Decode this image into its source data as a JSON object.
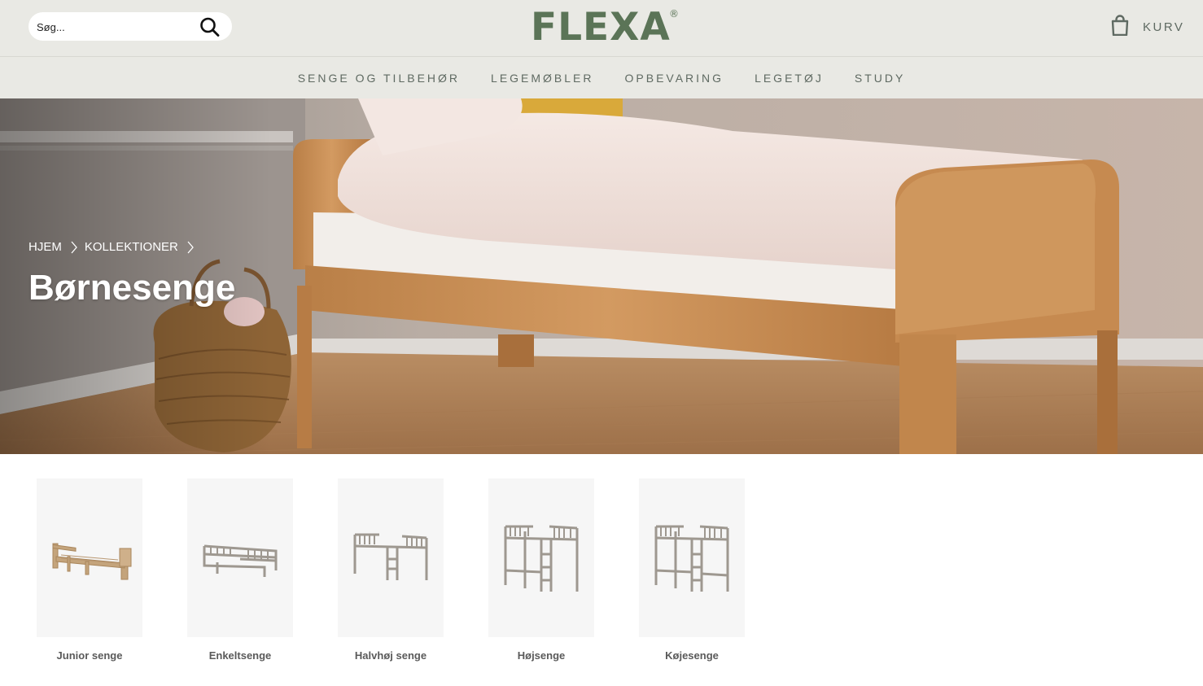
{
  "header": {
    "search_placeholder": "Søg...",
    "logo_text": "FLEXA",
    "logo_mark": "®",
    "cart_label": "KURV"
  },
  "nav": {
    "items": [
      "SENGE OG TILBEHØR",
      "LEGEMØBLER",
      "OPBEVARING",
      "LEGETØJ",
      "STUDY"
    ]
  },
  "hero": {
    "breadcrumb": [
      "HJEM",
      "KOLLEKTIONER"
    ],
    "title": "Børnesenge"
  },
  "categories": [
    {
      "label": "Junior senge",
      "icon": "junior-bed-image"
    },
    {
      "label": "Enkeltsenge",
      "icon": "single-bed-image"
    },
    {
      "label": "Halvhøj senge",
      "icon": "mid-sleeper-image"
    },
    {
      "label": "Højsenge",
      "icon": "high-bed-image"
    },
    {
      "label": "Køjesenge",
      "icon": "bunk-bed-image"
    }
  ],
  "colors": {
    "brand_green": "#5b7457",
    "header_bg": "#e9e9e4",
    "nav_text": "#5f6a62"
  }
}
